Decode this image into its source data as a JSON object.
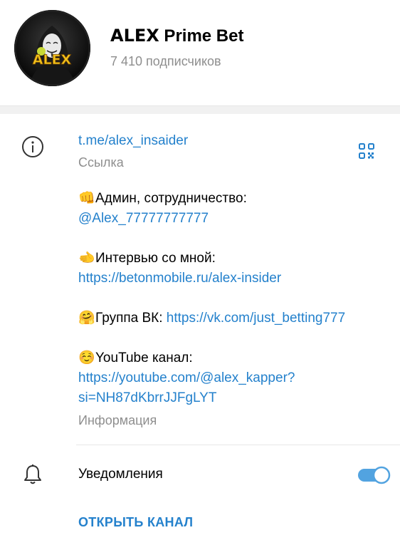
{
  "header": {
    "title": "𝗔𝗟𝗘𝗫 Prime Bet",
    "subscribers": "7 410 подписчиков",
    "avatar_text": "ALEX"
  },
  "info": {
    "link": "t.me/alex_insaider",
    "link_caption": "Ссылка",
    "admin_emoji": "👊",
    "admin_text": "Админ, сотрудничество:",
    "admin_handle": "@Alex_77777777777",
    "interview_emoji": "🫲",
    "interview_text": "Интервью со мной:",
    "interview_link": "https://betonmobile.ru/alex-insider",
    "vk_emoji": "🤗",
    "vk_text": "Группа ВК: ",
    "vk_link": "https://vk.com/just_betting777",
    "yt_emoji": "☺️",
    "yt_text": "YouTube канал:",
    "yt_link_line1": "https://youtube.com/@alex_kapper?",
    "yt_link_line2": "si=NH87dKbrrJJFgLYT",
    "info_caption": "Информация"
  },
  "notifications": {
    "label": "Уведомления",
    "enabled": true
  },
  "actions": {
    "open_channel": "ОТКРЫТЬ КАНАЛ"
  },
  "icons": {
    "info": "info-icon",
    "qr": "qr-code-icon",
    "bell": "bell-icon"
  },
  "colors": {
    "accent": "#2481cc",
    "muted": "#8e8e8e",
    "toggle": "#52a3e0"
  }
}
